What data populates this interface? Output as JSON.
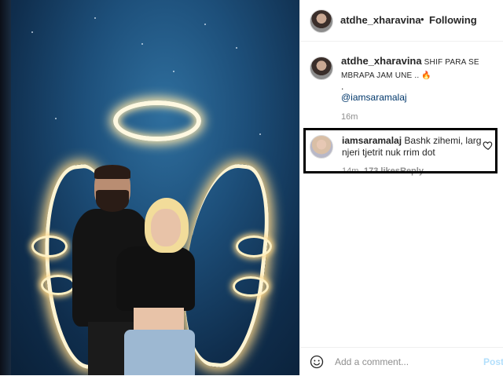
{
  "post": {
    "image_alt": "Couple posing in front of neon angel wings"
  },
  "header": {
    "username": "atdhe_xharavina",
    "separator": "•",
    "follow_status": "Following"
  },
  "caption": {
    "username": "atdhe_xharavina",
    "text": "SHIF PARA SE MBRAPA JAM UNE .. 🔥",
    "period": ".",
    "mention": "@iamsaramalaj",
    "time": "16m"
  },
  "comment": {
    "username": "iamsaramalaj",
    "text": "Bashk zihemi, larg njeri tjetrit nuk rrim dot",
    "time": "14m",
    "likes": "173 likes",
    "reply_label": "Reply"
  },
  "footer": {
    "placeholder": "Add a comment...",
    "post_label": "Post"
  },
  "colors": {
    "link": "#00376b",
    "muted": "#8e8e8e",
    "post_disabled": "#b2dffc",
    "highlight_box": "#000000"
  },
  "icons": [
    "heart-icon",
    "smiley-icon"
  ]
}
